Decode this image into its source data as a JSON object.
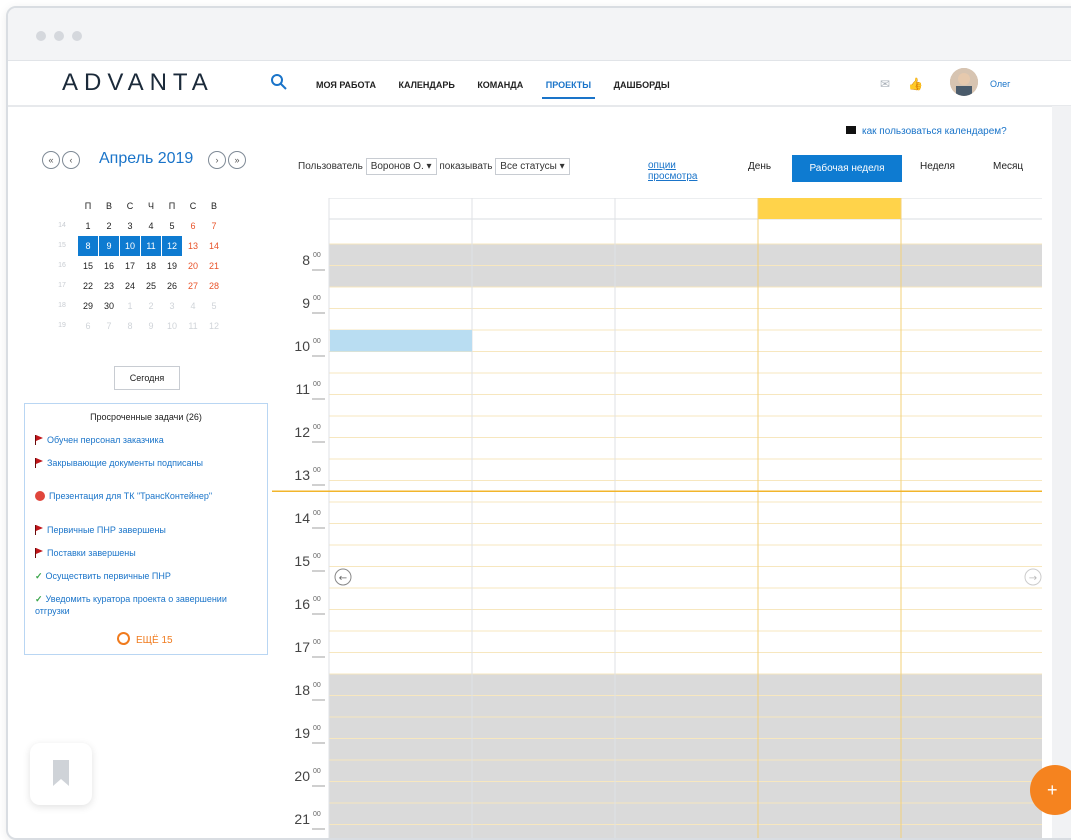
{
  "window": {
    "chrome_dots": 3
  },
  "topbar": {
    "logo": "ADVANTA",
    "nav": [
      "МОЯ РАБОТА",
      "КАЛЕНДАРЬ",
      "КОМАНДА",
      "ПРОЕКТЫ",
      "ДАШБОРДЫ"
    ],
    "active_nav": "ПРОЕКТЫ",
    "user_name": "Олег"
  },
  "calendar_nav": {
    "month": "Апрель 2019",
    "weekday_headers": [
      "П",
      "В",
      "С",
      "Ч",
      "П",
      "С",
      "В"
    ],
    "weeks": [
      {
        "wn": "14",
        "days": [
          "1",
          "2",
          "3",
          "4",
          "5",
          "6",
          "7"
        ]
      },
      {
        "wn": "15",
        "days": [
          "8",
          "9",
          "10",
          "11",
          "12",
          "13",
          "14"
        ],
        "selected_range": [
          0,
          4
        ]
      },
      {
        "wn": "16",
        "days": [
          "15",
          "16",
          "17",
          "18",
          "19",
          "20",
          "21"
        ]
      },
      {
        "wn": "17",
        "days": [
          "22",
          "23",
          "24",
          "25",
          "26",
          "27",
          "28"
        ]
      },
      {
        "wn": "18",
        "days": [
          "29",
          "30",
          "1",
          "2",
          "3",
          "4",
          "5"
        ],
        "dim_from": 2
      },
      {
        "wn": "19",
        "days": [
          "6",
          "7",
          "8",
          "9",
          "10",
          "11",
          "12"
        ],
        "dim_from": 0
      }
    ],
    "today_button": "Сегодня"
  },
  "overdue": {
    "title": "Просроченные задачи (26)",
    "tasks": [
      {
        "icon": "flag-icon",
        "text": "Обучен персонал заказчика"
      },
      {
        "icon": "flag-icon",
        "text": "Закрывающие документы подписаны"
      },
      {
        "icon": "stop-icon",
        "text": "Презентация для ТК \"ТрансКонтейнер\""
      },
      {
        "icon": "flag-icon",
        "text": "Первичные ПНР завершены"
      },
      {
        "icon": "flag-icon",
        "text": "Поставки завершены"
      },
      {
        "icon": "check-icon",
        "text": "Осуществить первичные ПНР"
      },
      {
        "icon": "check-icon",
        "text": "Уведомить куратора проекта о завершении отгрузки"
      }
    ],
    "more": "ЕЩЁ 15"
  },
  "filters": {
    "user_label": "Пользователь",
    "user_value": "Воронов О.",
    "show_label": "показывать",
    "show_value": "Все статусы",
    "view_options": "опции просмотра"
  },
  "help": {
    "how_to": "как пользоваться календарем?"
  },
  "views": {
    "day": "День",
    "workweek": "Рабочая неделя",
    "week": "Неделя",
    "month": "Месяц",
    "active": "workweek"
  },
  "schedule": {
    "hours": [
      "8",
      "9",
      "10",
      "11",
      "12",
      "13",
      "14",
      "15",
      "16",
      "17",
      "18",
      "19",
      "20",
      "21"
    ],
    "minutes": "00",
    "columns": 5,
    "today_column": 3,
    "current_time_hour": 13.75,
    "offhours_before": 9,
    "offhours_after": 18,
    "event": {
      "column": 0,
      "start": 10,
      "end": 10.5
    },
    "colors": {
      "accent": "#0e7bd1",
      "today_header": "#ffd34a",
      "offhours": "#dadada",
      "event": "#b9ddf2",
      "now_line": "#f2b52b",
      "grid_line": "#f7e7bf"
    }
  }
}
